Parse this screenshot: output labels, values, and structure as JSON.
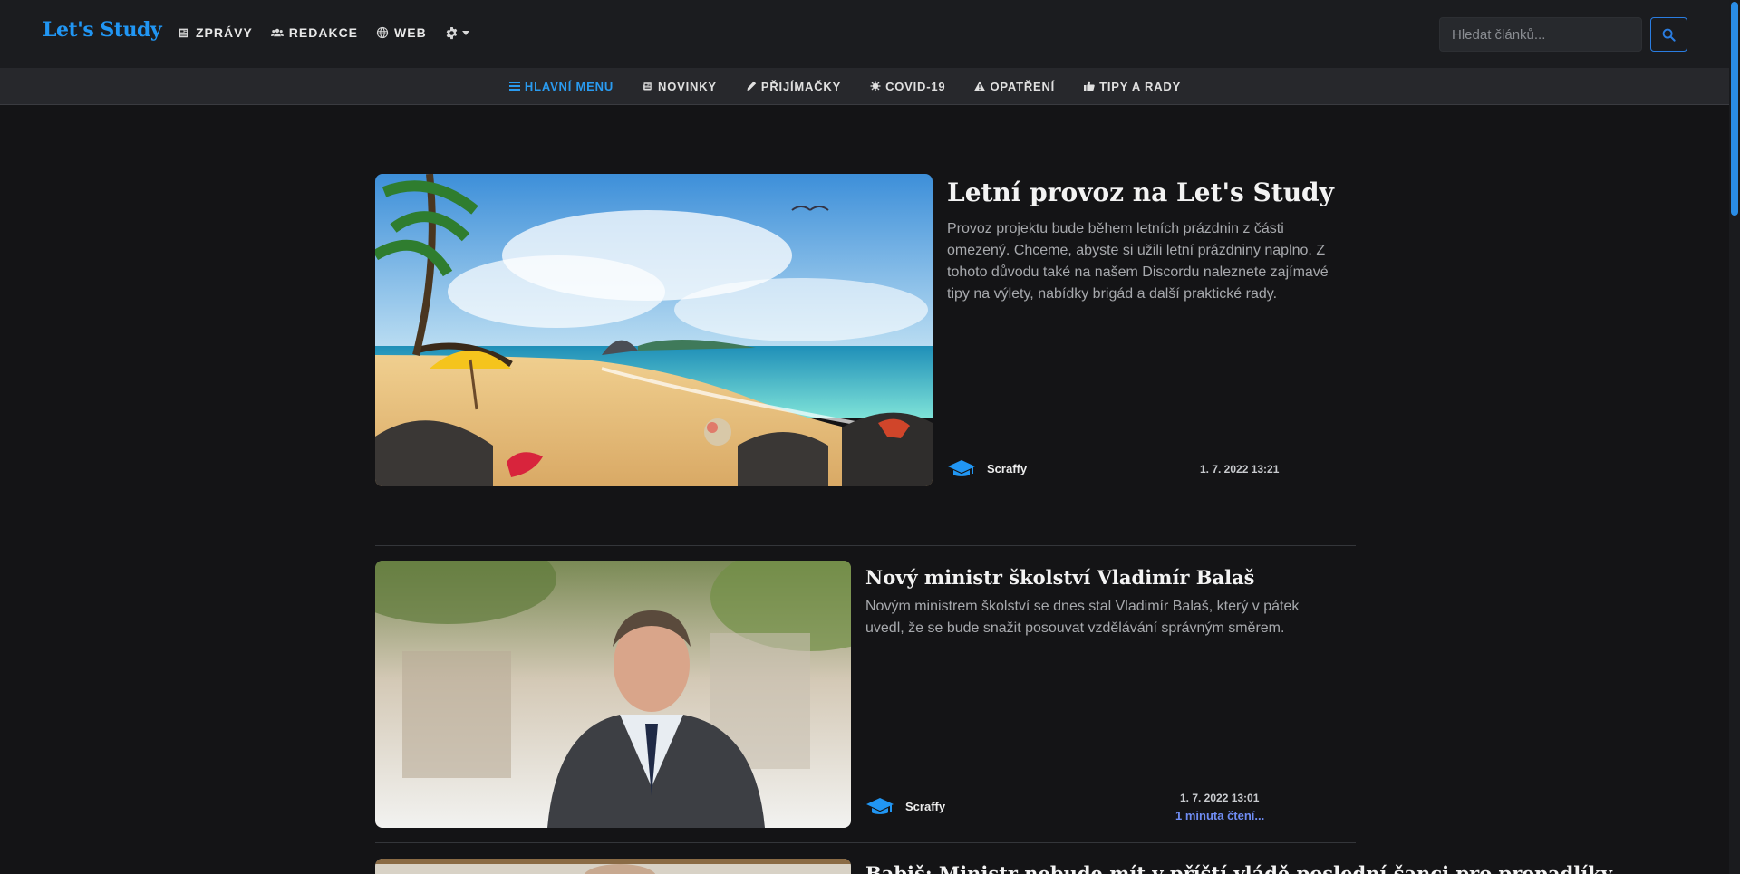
{
  "brand": "Let's Study",
  "topnav": {
    "news": "ZPRÁVY",
    "team": "REDAKCE",
    "web": "WEB"
  },
  "search": {
    "placeholder": "Hledat článků..."
  },
  "subnav": {
    "main_menu": "HLAVNÍ MENU",
    "news": "NOVINKY",
    "admissions": "PŘIJÍMAČKY",
    "covid": "COVID-19",
    "measures": "OPATŘENÍ",
    "tips": "TIPY A RADY"
  },
  "articles": [
    {
      "title": "Letní provoz na Let's Study",
      "text": "Provoz projektu bude během letních prázdnin z části omezený. Chceme, abyste si užili letní prázdniny naplno. Z tohoto důvodu také na našem Discordu naleznete zajímavé tipy na výlety, nabídky brigád a další praktické rady.",
      "author": "Scraffy",
      "date": "1. 7. 2022 13:21",
      "image": "beach-illustration"
    },
    {
      "title": "Nový ministr školství Vladimír Balaš",
      "text": "Novým ministrem školství se dnes stal Vladimír Balaš, který v pátek uvedl, že se bude snažit posouvat vzdělávání správným směrem.",
      "author": "Scraffy",
      "date": "1. 7. 2022 13:01",
      "read_time": "1 minuta čtení...",
      "image": "portrait-photo"
    },
    {
      "title": "Babiš: Ministr nebude mít v příští vládě poslední šanci pro propadlíky",
      "image": "photo"
    }
  ],
  "colors": {
    "accent": "#2196f3",
    "background": "#141416",
    "read_more": "#6f8cf2"
  }
}
